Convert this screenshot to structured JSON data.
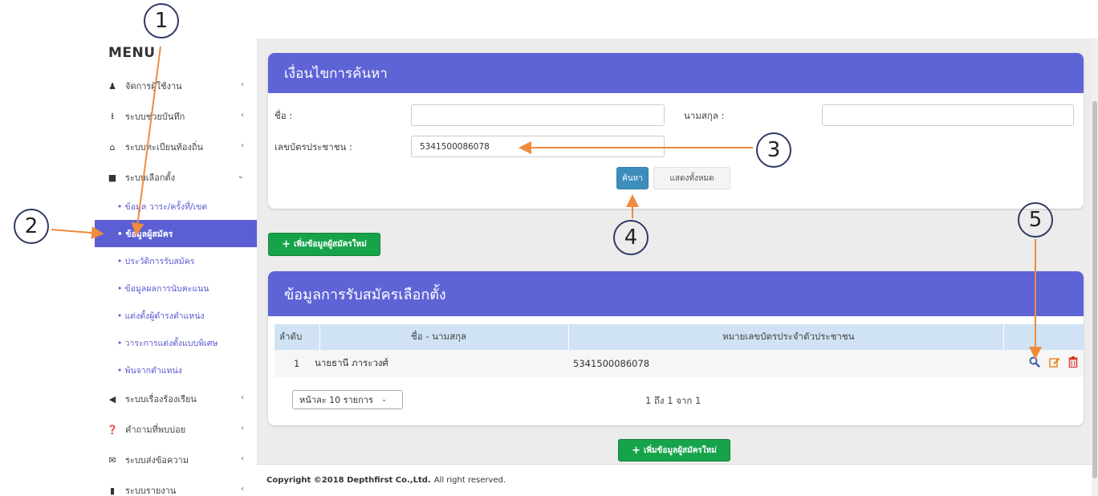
{
  "sidebar": {
    "title": "MENU",
    "items": [
      {
        "label": "จัดการผู้ใช้งาน",
        "icon": "user-icon",
        "chevron": "‹"
      },
      {
        "label": "ระบบช่วยบันทึก",
        "icon": "download-icon",
        "chevron": "‹"
      },
      {
        "label": "ระบบทะเบียนท้องถิ่น",
        "icon": "bank-icon",
        "chevron": "‹"
      },
      {
        "label": "ระบบเลือกตั้ง",
        "icon": "briefcase-icon",
        "chevron": "⌄"
      }
    ],
    "subitems": [
      "• ข้อมูล วาระ/ครั้งที่/เขต",
      "• ข้อมูลผู้สมัคร",
      "• ประวัติการรับสมัคร",
      "• ข้อมูลผลการนับคะแนน",
      "• แต่งตั้งผู้ดำรงตำแหน่ง",
      "• วาระการแต่งตั้งแบบพิเศษ",
      "• พ้นจากตำแหน่ง"
    ],
    "items_bottom": [
      {
        "label": "ระบบเรื่องร้องเรียน",
        "icon": "bullhorn-icon",
        "chevron": "‹"
      },
      {
        "label": "คำถามที่พบบ่อย",
        "icon": "question-icon",
        "chevron": "‹"
      },
      {
        "label": "ระบบส่งข้อความ",
        "icon": "envelope-icon",
        "chevron": "‹"
      },
      {
        "label": "ระบบรายงาน",
        "icon": "file-icon",
        "chevron": "‹"
      }
    ]
  },
  "search": {
    "title": "เงื่อนไขการค้นหา",
    "name_label": "ชื่อ :",
    "name_value": "",
    "surname_label": "นามสกุล :",
    "surname_value": "",
    "idcard_label": "เลขบัตรประชาชน :",
    "idcard_value": "5341500086078",
    "search_button": "ค้นหา",
    "showall_button": "แสดงทั้งหมด"
  },
  "add_button": "เพิ่มข้อมูลผู้สมัครใหม่",
  "results": {
    "title": "ข้อมูลการรับสมัครเลือกตั้ง",
    "headers": [
      "ลำดับ",
      "ชื่อ - นามสกุล",
      "หมายเลขบัตรประจำตัวประชาชน"
    ],
    "rows": [
      {
        "no": "1",
        "name": "นายธานี ภาระวงศ์",
        "idcard": "5341500086078"
      }
    ],
    "page_size": "หน้าละ 10 รายการ",
    "pagination": "1 ถึง 1 จาก 1"
  },
  "footer": {
    "copyright": "Copyright ©2018 Depthfirst Co.,Ltd.",
    "rights": "All right reserved."
  },
  "annotations": [
    "1",
    "2",
    "3",
    "4",
    "5"
  ],
  "colors": {
    "accent": "#5e63d6",
    "primary_button": "#3c8dbc",
    "success_button": "#16a34a",
    "annotation_arrow": "#f08a3c"
  }
}
